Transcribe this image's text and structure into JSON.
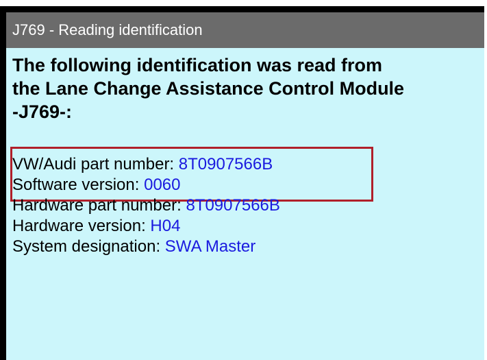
{
  "window": {
    "title": "J769 - Reading identification"
  },
  "message": {
    "lines": [
      "The following identification was read from",
      "the Lane Change Assistance Control Module",
      "-J769-:"
    ]
  },
  "identification": [
    {
      "label": "VW/Audi part number:",
      "value": "8T0907566B"
    },
    {
      "label": "Software version:",
      "value": "0060"
    },
    {
      "label": "Hardware part number:",
      "value": "8T0907566B"
    },
    {
      "label": "Hardware version:",
      "value": "H04"
    },
    {
      "label": "System designation:",
      "value": "SWA Master"
    }
  ],
  "colors": {
    "title_bar": "#6b6b6b",
    "content_background": "#ccf6fb",
    "value_text": "#1a1adf",
    "highlight_border": "#b0202a"
  }
}
